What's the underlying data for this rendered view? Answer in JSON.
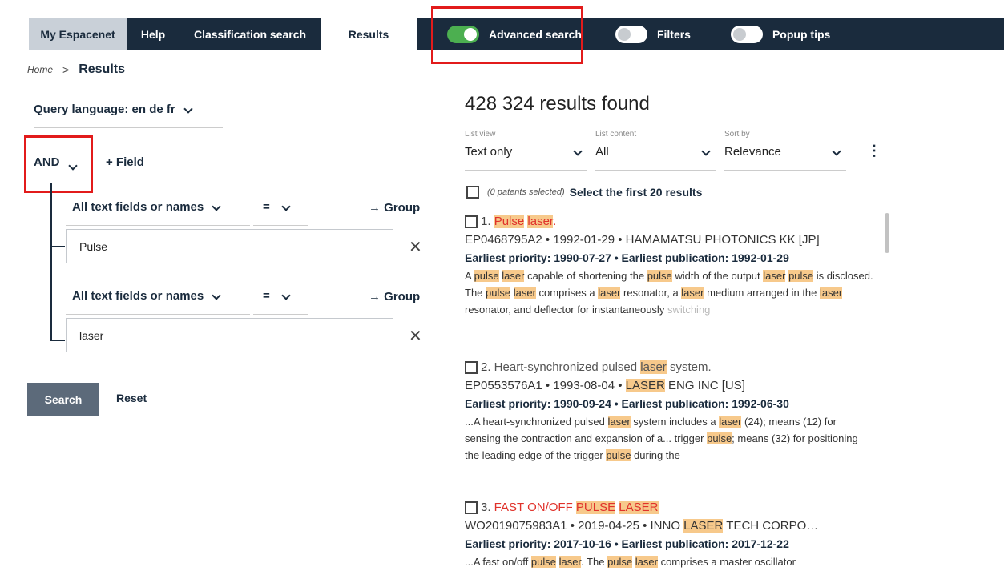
{
  "nav": {
    "tabs": [
      "My Espacenet",
      "Help",
      "Classification search",
      "Results"
    ],
    "toggles": [
      {
        "label": "Advanced search",
        "on": true
      },
      {
        "label": "Filters",
        "on": false
      },
      {
        "label": "Popup tips",
        "on": false
      }
    ]
  },
  "breadcrumb": {
    "home": "Home",
    "sep": ">",
    "current": "Results"
  },
  "query": {
    "language_label": "Query language: en de fr",
    "operator": "AND",
    "add_field": "+ Field",
    "group_label": "→ Group",
    "fields": [
      {
        "field": "All text fields or names",
        "op": "=",
        "value": "Pulse"
      },
      {
        "field": "All text fields or names",
        "op": "=",
        "value": "laser"
      }
    ],
    "clear": "✕",
    "search": "Search",
    "reset": "Reset"
  },
  "results": {
    "count": "428 324 results found",
    "list_view": {
      "label": "List view",
      "value": "Text only"
    },
    "list_content": {
      "label": "List content",
      "value": "All"
    },
    "sort_by": {
      "label": "Sort by",
      "value": "Relevance"
    },
    "more": "⋮",
    "selected_note": "(0 patents selected)",
    "select_first": "Select the first 20 results",
    "items": [
      {
        "num": "1.",
        "meta": "EP0468795A2 • 1992-01-29 • HAMAMATSU PHOTONICS KK [JP]",
        "priority": "Earliest priority: 1990-07-27 • Earliest publication: 1992-01-29"
      },
      {
        "num": "2.",
        "meta_suffix": "ENG INC [US]",
        "priority": "Earliest priority: 1990-09-24 • Earliest publication: 1992-06-30"
      },
      {
        "num": "3.",
        "meta_prefix": "WO2019075983A1 • 2019-04-25 • INNO",
        "meta_suffix": "TECH CORPO…",
        "priority": "Earliest priority: 2017-10-16 • Earliest publication: 2017-12-22"
      }
    ]
  },
  "colors": {
    "nav_bg": "#1a2b3d",
    "toggle_on": "#4caf50",
    "highlight": "#f7c98b",
    "annotation_red": "#e21b1b",
    "title_red": "#e0322b"
  }
}
